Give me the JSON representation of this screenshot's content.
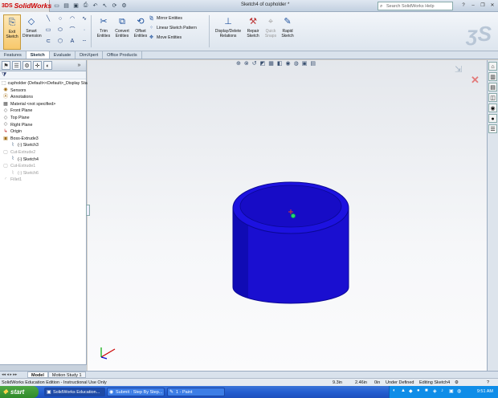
{
  "app": {
    "name": "SolidWorks",
    "ds": "3DS",
    "window_title": "Sketch4 of cupholder *"
  },
  "search": {
    "placeholder": "Search SolidWorks Help"
  },
  "quick_access": [
    "new",
    "open",
    "save",
    "print",
    "undo",
    "select",
    "rebuild",
    "options"
  ],
  "ribbon": {
    "exit_sketch": "Exit Sketch",
    "smart_dimension": "Smart Dimension",
    "trim": "Trim Entities",
    "convert": "Convert Entities",
    "offset": "Offset Entities",
    "mirror": "Mirror Entities",
    "linear_pattern": "Linear Sketch Pattern",
    "move": "Move Entities",
    "display_delete": "Display/Delete Relations",
    "repair": "Repair Sketch",
    "quick_snaps": "Quick Snaps",
    "rapid": "Rapid Sketch"
  },
  "tabs": [
    "Features",
    "Sketch",
    "Evaluate",
    "DimXpert",
    "Office Products"
  ],
  "active_tab": "Sketch",
  "tree": {
    "root": "cupholder  (Default<<Default>_Display Stat",
    "items": [
      {
        "label": "Sensors",
        "dim": false
      },
      {
        "label": "Annotations",
        "dim": false
      },
      {
        "label": "Material <not specified>",
        "dim": false
      },
      {
        "label": "Front Plane",
        "dim": false
      },
      {
        "label": "Top Plane",
        "dim": false
      },
      {
        "label": "Right Plane",
        "dim": false
      },
      {
        "label": "Origin",
        "dim": false
      },
      {
        "label": "Boss-Extrude3",
        "dim": false
      },
      {
        "label": "(-) Sketch3",
        "dim": false
      },
      {
        "label": "Cut-Extrude2",
        "dim": true
      },
      {
        "label": "(-) Sketch4",
        "dim": false
      },
      {
        "label": "Cut-Extrude1",
        "dim": true
      },
      {
        "label": "(-) Sketch6",
        "dim": true
      },
      {
        "label": "Fillet1",
        "dim": true
      }
    ]
  },
  "lower_tabs": [
    "Model",
    "Motion Study 1"
  ],
  "status": {
    "edition": "SolidWorks Education Edition - Instructional Use Only",
    "x": "9.3in",
    "y": "2.46in",
    "z": "0in",
    "state": "Under Defined",
    "editing": "Editing Sketch4"
  },
  "taskbar": {
    "start": "start",
    "buttons": [
      "SolidWorks Education...",
      "Submit : Step By Step...",
      "1 - Paint"
    ],
    "time": "9:51 AM"
  },
  "colors": {
    "model": "#1a0fd0",
    "model_dark": "#0b0896",
    "accent": "#c00000"
  }
}
